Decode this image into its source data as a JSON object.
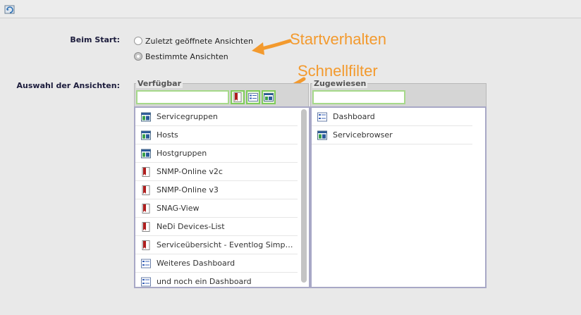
{
  "toolbar": {
    "icon": "reload-icon"
  },
  "start": {
    "label": "Beim Start:",
    "options": [
      {
        "label": "Zuletzt geöffnete Ansichten",
        "checked": false
      },
      {
        "label": "Bestimmte Ansichten",
        "checked": true
      }
    ]
  },
  "selection": {
    "label": "Auswahl der Ansichten:"
  },
  "annotations": {
    "start": "Startverhalten",
    "filter": "Schnellfilter"
  },
  "available": {
    "title": "Verfügbar",
    "filter_value": "",
    "items": [
      {
        "label": "Servicegruppen",
        "icon": "grid-icon"
      },
      {
        "label": "Hosts",
        "icon": "grid-icon"
      },
      {
        "label": "Hostgruppen",
        "icon": "grid-icon"
      },
      {
        "label": "SNMP-Online v2c",
        "icon": "bookmark-icon"
      },
      {
        "label": "SNMP-Online v3",
        "icon": "bookmark-icon"
      },
      {
        "label": "SNAG-View",
        "icon": "bookmark-icon"
      },
      {
        "label": "NeDi Devices-List",
        "icon": "bookmark-icon"
      },
      {
        "label": "Serviceübersicht - Eventlog Simp…",
        "icon": "bookmark-icon"
      },
      {
        "label": "Weiteres Dashboard",
        "icon": "dashboard-icon"
      },
      {
        "label": "und noch ein Dashboard",
        "icon": "dashboard-icon"
      }
    ]
  },
  "assigned": {
    "title": "Zugewiesen",
    "filter_value": "",
    "items": [
      {
        "label": "Dashboard",
        "icon": "dashboard-icon"
      },
      {
        "label": "Servicebrowser",
        "icon": "grid-icon"
      }
    ]
  },
  "colors": {
    "accent": "#f39a2e",
    "filter_green": "#7fcc5a",
    "list_border": "#a8a8c6"
  }
}
